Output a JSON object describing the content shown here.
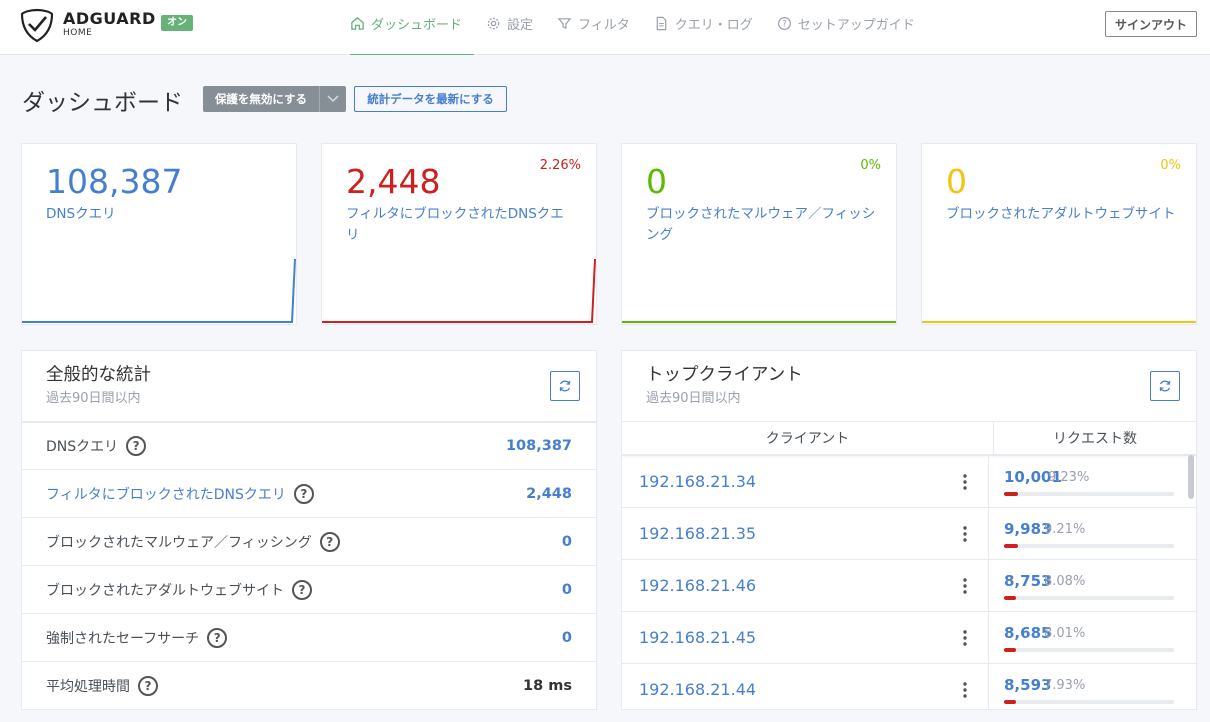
{
  "header": {
    "brand": "ADGUARD",
    "brand_sub": "HOME",
    "status_badge": "オン",
    "nav": [
      {
        "label": "ダッシュボード",
        "icon": "home-icon"
      },
      {
        "label": "設定",
        "icon": "gear-icon"
      },
      {
        "label": "フィルタ",
        "icon": "filter-icon"
      },
      {
        "label": "クエリ・ログ",
        "icon": "document-icon"
      },
      {
        "label": "セットアップガイド",
        "icon": "help-circle-icon"
      }
    ],
    "signout": "サインアウト"
  },
  "title_row": {
    "title": "ダッシュボード",
    "disable_protection": "保護を無効にする",
    "refresh_stats": "統計データを最新にする"
  },
  "stat_cards": [
    {
      "value": "108,387",
      "label": "DNSクエリ",
      "percent": "",
      "color": "#467fcf"
    },
    {
      "value": "2,448",
      "label": "フィルタにブロックされたDNSクエリ",
      "percent": "2.26%",
      "color": "#cd201f"
    },
    {
      "value": "0",
      "label": "ブロックされたマルウェア／フィッシング",
      "percent": "0%",
      "color": "#5eba00"
    },
    {
      "value": "0",
      "label": "ブロックされたアダルトウェブサイト",
      "percent": "0%",
      "color": "#f1c40f"
    }
  ],
  "general_stats": {
    "title": "全般的な統計",
    "subtitle": "過去90日間以内",
    "rows": [
      {
        "label": "DNSクエリ",
        "value": "108,387"
      },
      {
        "label": "フィルタにブロックされたDNSクエリ",
        "value": "2,448"
      },
      {
        "label": "ブロックされたマルウェア／フィッシング",
        "value": "0"
      },
      {
        "label": "ブロックされたアダルトウェブサイト",
        "value": "0"
      },
      {
        "label": "強制されたセーフサーチ",
        "value": "0"
      },
      {
        "label": "平均処理時間",
        "value": "18 ms"
      }
    ]
  },
  "top_clients": {
    "title": "トップクライアント",
    "subtitle": "過去90日間以内",
    "columns": [
      "クライアント",
      "リクエスト数"
    ],
    "rows": [
      {
        "ip": "192.168.21.34",
        "count": "10,001",
        "percent": "9.23%",
        "fraction": 0.0923
      },
      {
        "ip": "192.168.21.35",
        "count": "9,983",
        "percent": "9.21%",
        "fraction": 0.0921
      },
      {
        "ip": "192.168.21.46",
        "count": "8,753",
        "percent": "8.08%",
        "fraction": 0.0808
      },
      {
        "ip": "192.168.21.45",
        "count": "8,685",
        "percent": "8.01%",
        "fraction": 0.0801
      },
      {
        "ip": "192.168.21.44",
        "count": "8,593",
        "percent": "7.93%",
        "fraction": 0.0793
      }
    ]
  }
}
